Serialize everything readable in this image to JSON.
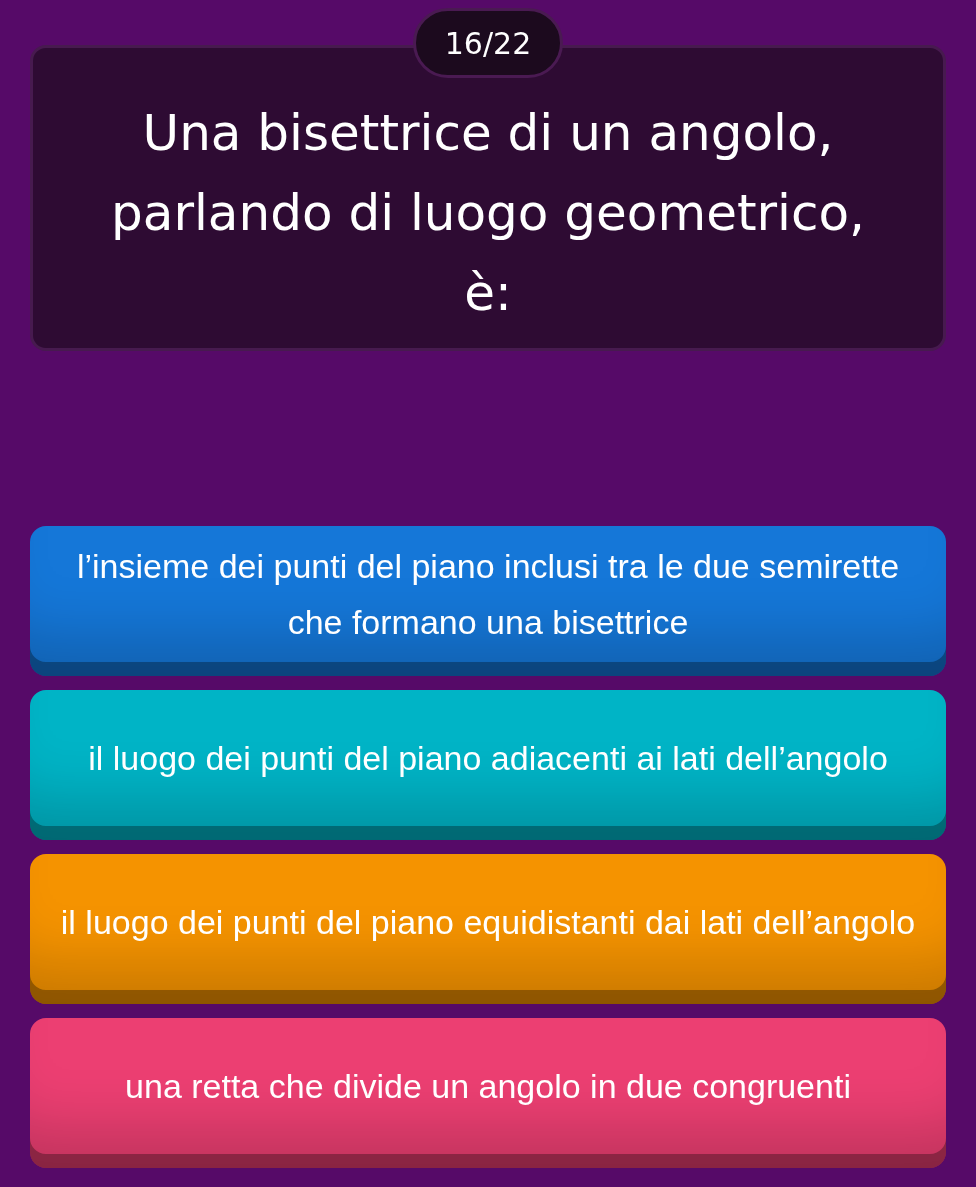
{
  "counter": "16/22",
  "question": "Una bisettrice di un angolo, parlando di luogo geometrico, è:",
  "answers": [
    {
      "text": "l’insieme dei punti del piano inclusi tra le due semirette che formano una bisettrice",
      "color": "#1577d8"
    },
    {
      "text": "il luogo dei punti del piano adiacenti ai lati dell’angolo",
      "color": "#00b4c6"
    },
    {
      "text": "il luogo dei punti del piano equidistanti dai lati dell’angolo",
      "color": "#f59300"
    },
    {
      "text": "una retta che divide un angolo in due congruenti",
      "color": "#ec3f72"
    }
  ]
}
